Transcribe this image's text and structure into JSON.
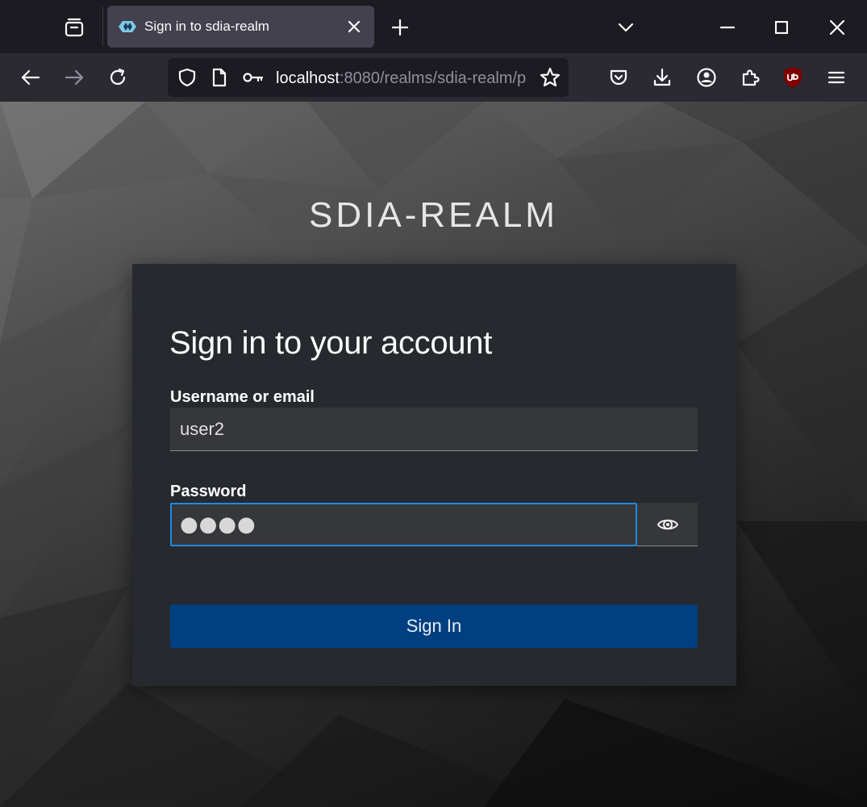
{
  "browser": {
    "tab": {
      "title": "Sign in to sdia-realm",
      "close_glyph": "×"
    },
    "url": {
      "host": "localhost",
      "path": ":8080/realms/sdia-realm/p"
    },
    "icons": {
      "tab_overview": "folder-tabs-icon",
      "new_tab": "plus-icon",
      "tab_list": "chevron-down-icon",
      "back": "arrow-left-icon",
      "forward": "arrow-right-icon",
      "reload": "reload-icon",
      "shield": "shield-icon",
      "page": "page-icon",
      "key": "key-icon",
      "bookmark": "star-icon",
      "pocket": "pocket-icon",
      "downloads": "download-icon",
      "account": "account-icon",
      "extensions": "puzzle-icon",
      "ublock": "ublock-icon",
      "menu": "hamburger-icon"
    },
    "colors": {
      "tabstrip": "#1c1b22",
      "toolbar": "#2b2a33",
      "active_tab": "#42414d"
    }
  },
  "page": {
    "realm_title": "SDIA-REALM",
    "card": {
      "heading": "Sign in to your account",
      "username": {
        "label": "Username or email",
        "value": "user2"
      },
      "password": {
        "label": "Password",
        "masked_value": "●●●●",
        "toggle_icon": "eye-icon"
      },
      "submit_label": "Sign In"
    },
    "colors": {
      "card_bg": "#26292d",
      "input_bg": "#36373b",
      "focus_border": "#1f8ae0",
      "primary_button": "#004080"
    }
  }
}
